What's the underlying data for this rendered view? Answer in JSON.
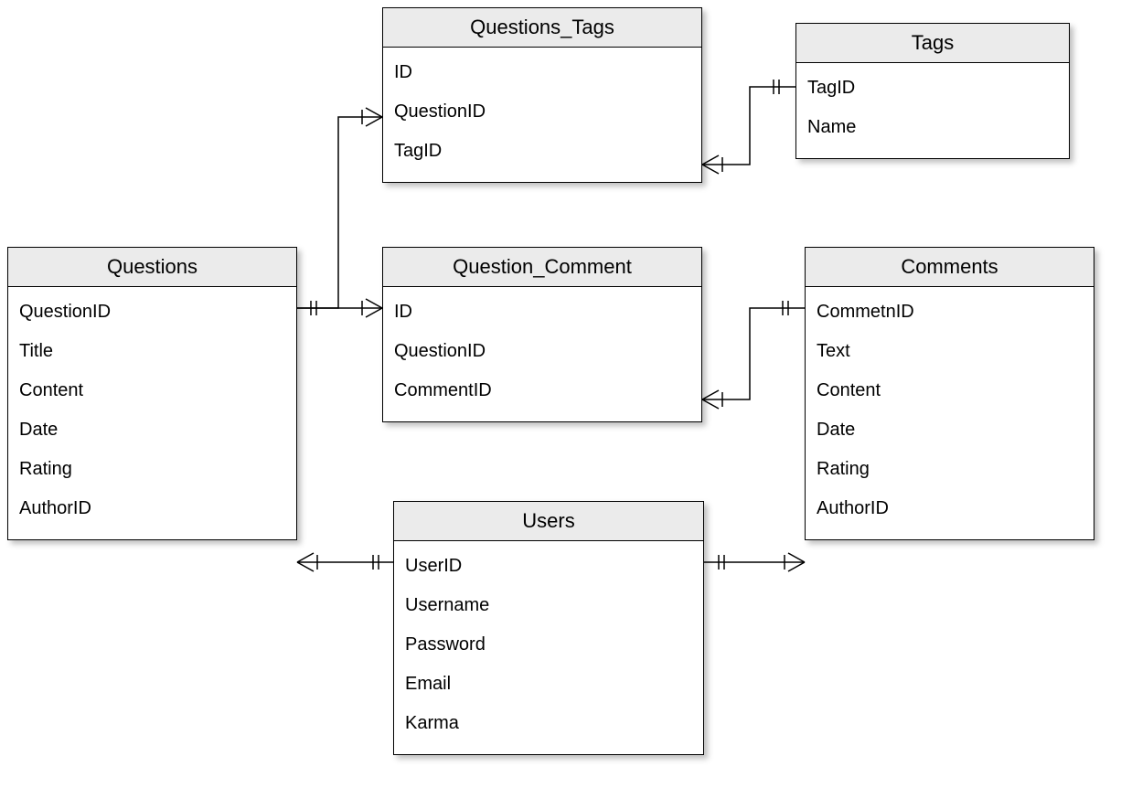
{
  "entities": {
    "questions_tags": {
      "title": "Questions_Tags",
      "fields": [
        "ID",
        "QuestionID",
        "TagID"
      ]
    },
    "tags": {
      "title": "Tags",
      "fields": [
        "TagID",
        "Name"
      ]
    },
    "questions": {
      "title": "Questions",
      "fields": [
        "QuestionID",
        "Title",
        "Content",
        "Date",
        "Rating",
        "AuthorID"
      ]
    },
    "question_comment": {
      "title": "Question_Comment",
      "fields": [
        "ID",
        "QuestionID",
        "CommentID"
      ]
    },
    "comments": {
      "title": "Comments",
      "fields": [
        "CommetnID",
        "Text",
        "Content",
        "Date",
        "Rating",
        "AuthorID"
      ]
    },
    "users": {
      "title": "Users",
      "fields": [
        "UserID",
        "Username",
        "Password",
        "Email",
        "Karma"
      ]
    }
  },
  "relationships": [
    {
      "from": "Questions",
      "to": "Questions_Tags",
      "type": "one-to-many"
    },
    {
      "from": "Tags",
      "to": "Questions_Tags",
      "type": "one-to-many"
    },
    {
      "from": "Questions",
      "to": "Question_Comment",
      "type": "one-to-many"
    },
    {
      "from": "Comments",
      "to": "Question_Comment",
      "type": "one-to-many"
    },
    {
      "from": "Users",
      "to": "Questions",
      "type": "one-to-many"
    },
    {
      "from": "Users",
      "to": "Comments",
      "type": "one-to-many"
    }
  ]
}
